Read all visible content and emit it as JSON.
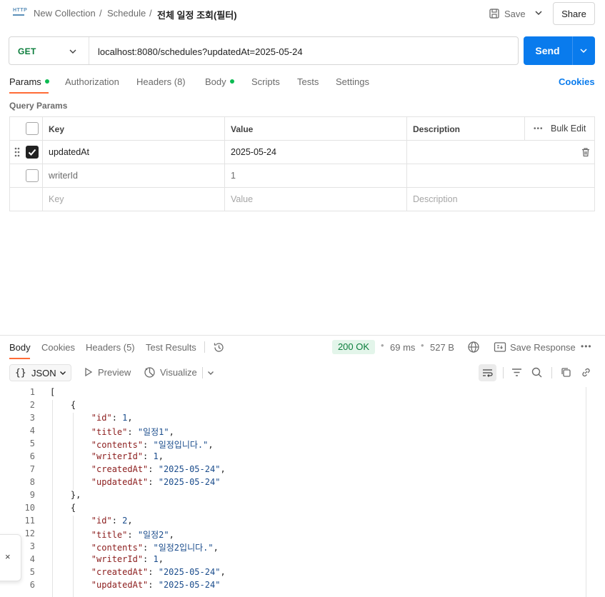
{
  "header": {
    "breadcrumb": [
      "New Collection",
      "Schedule",
      "전체 일정 조회(필터)"
    ],
    "separator": "/",
    "save_label": "Save",
    "share_label": "Share"
  },
  "request": {
    "method": "GET",
    "url": "localhost:8080/schedules?updatedAt=2025-05-24",
    "send_label": "Send",
    "tabs": [
      "Params",
      "Authorization",
      "Headers (8)",
      "Body",
      "Scripts",
      "Tests",
      "Settings"
    ],
    "cookies_label": "Cookies",
    "section_title": "Query Params"
  },
  "params_table": {
    "headers": {
      "key": "Key",
      "value": "Value",
      "description": "Description",
      "bulk_edit": "Bulk Edit"
    },
    "rows": [
      {
        "key": "updatedAt",
        "value": "2025-05-24",
        "description": "",
        "checked": true
      },
      {
        "key": "writerId",
        "value": "1",
        "description": "",
        "checked": false
      }
    ],
    "placeholders": {
      "key": "Key",
      "value": "Value",
      "description": "Description"
    }
  },
  "response": {
    "tabs": [
      "Body",
      "Cookies",
      "Headers (5)",
      "Test Results"
    ],
    "status": "200 OK",
    "time": "69 ms",
    "size": "527 B",
    "save_response_label": "Save Response",
    "format_label": "JSON",
    "format_braces": "{}",
    "preview_label": "Preview",
    "visualize_label": "Visualize",
    "lines": [
      "[",
      "    {",
      "        \"id\": 1,",
      "        \"title\": \"일정1\",",
      "        \"contents\": \"일정입니다.\",",
      "        \"writerId\": 1,",
      "        \"createdAt\": \"2025-05-24\",",
      "        \"updatedAt\": \"2025-05-24\"",
      "    },",
      "    {",
      "        \"id\": 2,",
      "        \"title\": \"일정2\",",
      "        \"contents\": \"일정2입니다.\",",
      "        \"writerId\": 1,",
      "        \"createdAt\": \"2025-05-24\",",
      "        \"updatedAt\": \"2025-05-24\""
    ],
    "line_numbers": [
      "1",
      "2",
      "3",
      "4",
      "5",
      "6",
      "7",
      "8",
      "9",
      "10",
      "11",
      "12",
      "3",
      "4",
      "5",
      "6"
    ]
  },
  "float_panel": {
    "close_glyph": "×"
  },
  "colors": {
    "accent": "#097bed",
    "tab_underline": "#ff6c37",
    "status_green": "#0a7d3b"
  }
}
